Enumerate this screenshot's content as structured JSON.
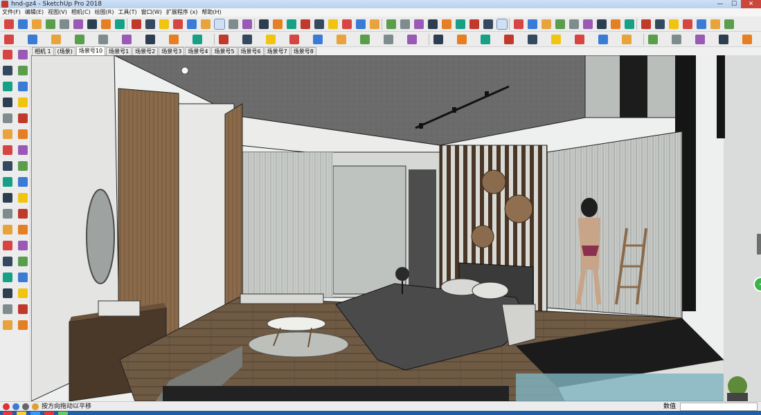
{
  "window": {
    "title": "hnd-gz4 - SketchUp Pro 2018",
    "controls": {
      "minimize": "—",
      "maximize": "☐",
      "close": "✕"
    }
  },
  "menus": [
    "文件(F)",
    "编辑(E)",
    "视图(V)",
    "相机(C)",
    "绘图(R)",
    "工具(T)",
    "窗口(W)",
    "扩展程序 (x)",
    "帮助(H)"
  ],
  "scene_tabs": [
    "相机 1",
    "(场景)",
    "场景号10",
    "场景号1",
    "场景号2",
    "场景号3",
    "场景号4",
    "场景号5",
    "场景号6",
    "场景号7",
    "场景号8"
  ],
  "active_scene_tab": 2,
  "status": {
    "hint": "按方向拖动以平移",
    "measurements_label": "数值",
    "measurements_value": ""
  },
  "toolbar_icons": {
    "row1": [
      "select",
      "eraser",
      "line",
      "arc",
      "shape",
      "push-pull",
      "move",
      "rotate",
      "scale",
      "offset",
      "tape-measure",
      "text",
      "paint-bucket",
      "orbit",
      "pan",
      "zoom",
      "zoom-extents",
      "component",
      "group",
      "warehouse",
      "extension-warehouse",
      "styles",
      "section-plane",
      "display-section",
      "axes",
      "dimensions",
      "protractor",
      "3d-text",
      "walk",
      "look-around",
      "position-camera",
      "iso-view",
      "top-view",
      "front-view",
      "right-view",
      "back-view",
      "left-view",
      "x-ray",
      "wireframe",
      "hidden-line",
      "shaded",
      "shaded-textures",
      "monochrome",
      "sandbox-contours",
      "sandbox-scratch",
      "smoove",
      "stamp",
      "drape",
      "add-detail",
      "flip-edge",
      "layers",
      "outliner"
    ],
    "row2": [
      "move-tool",
      "follow-me",
      "intersect",
      "union",
      "subtract",
      "trim",
      "split",
      "outer-shell",
      "solid-inspector",
      "round-corner",
      "bezier",
      "weld",
      "extrude",
      "shape-bender",
      "joint-push-pull",
      "fredo-scale",
      "curviloft",
      "tools-on-surface",
      "randomizer",
      "material-replacer",
      "profile-builder",
      "stairs",
      "roof",
      "windows",
      "doors",
      "cleanup",
      "purge",
      "render-settings",
      "render",
      "interactive-render",
      "lights",
      "exposure"
    ]
  },
  "colors": {
    "accent": "#1f5ea8",
    "close_button": "#c9483b",
    "viewport_bg": "#eef0ef",
    "wood": "#7a5a3c",
    "ceiling": "#6a6a6a"
  }
}
